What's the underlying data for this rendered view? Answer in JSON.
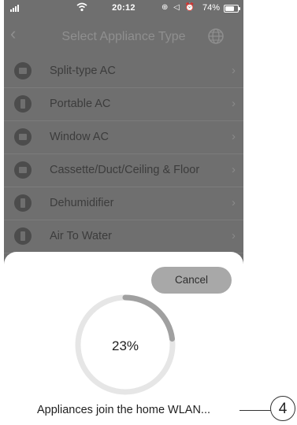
{
  "status_bar": {
    "time": "20:12",
    "status_icons": "⊕ ◁ ⏰",
    "battery_percent": "74%",
    "battery_level": 0.74
  },
  "nav": {
    "back_icon": "chevron-left-icon",
    "title": "Select Appliance Type",
    "globe_icon": "globe-icon"
  },
  "appliances": [
    {
      "label": "Split-type AC",
      "icon": "split-ac-icon"
    },
    {
      "label": "Portable AC",
      "icon": "portable-ac-icon"
    },
    {
      "label": "Window AC",
      "icon": "window-ac-icon"
    },
    {
      "label": "Cassette/Duct/Ceiling & Floor",
      "icon": "cassette-icon"
    },
    {
      "label": "Dehumidifier",
      "icon": "dehumidifier-icon"
    },
    {
      "label": "Air To Water",
      "icon": "air-to-water-icon"
    }
  ],
  "sheet": {
    "cancel_label": "Cancel",
    "progress_text": "23%",
    "progress_value": 0.23,
    "message": "Appliances join the home WLAN..."
  },
  "callout": {
    "number": "4"
  },
  "colors": {
    "overlay": "#6f6f6f",
    "progress_track": "#e6e6e6",
    "progress_fill": "#a0a0a0",
    "cancel_bg": "#a8a8a8"
  }
}
